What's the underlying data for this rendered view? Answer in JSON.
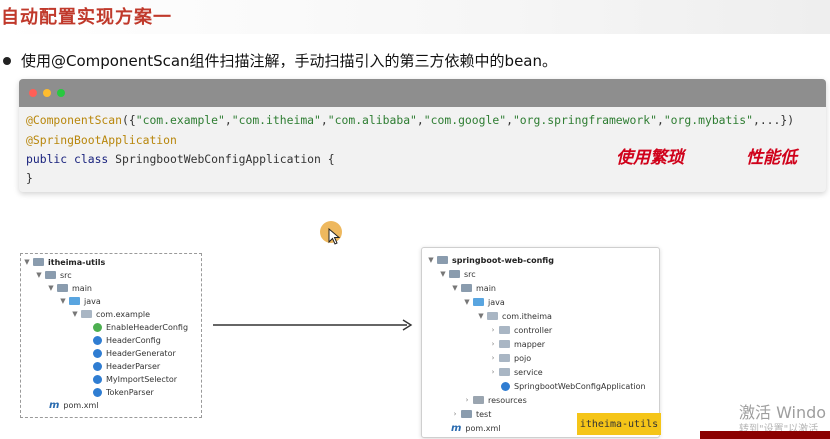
{
  "slide": {
    "title": "自动配置实现方案一",
    "bullet": "使用@ComponentScan组件扫描注解，手动扫描引入的第三方依赖中的bean。"
  },
  "code": {
    "line1": {
      "annotation": "@ComponentScan",
      "open": "({",
      "items": [
        "\"com.example\"",
        "\"com.itheima\"",
        "\"com.alibaba\"",
        "\"com.google\"",
        "\"org.springframework\"",
        "\"org.mybatis\""
      ],
      "tail": ",...})"
    },
    "line2": "@SpringBootApplication",
    "line3": {
      "keyword": "public class",
      "rest": " SpringbootWebConfigApplication {"
    },
    "line4": "}",
    "note_left": "使用繁琐",
    "note_right": "性能低"
  },
  "left_tree": {
    "root": "itheima-utils",
    "src": "src",
    "main": "main",
    "java": "java",
    "package": "com.example",
    "classes": [
      "EnableHeaderConfig",
      "HeaderConfig",
      "HeaderGenerator",
      "HeaderParser",
      "MyImportSelector",
      "TokenParser"
    ],
    "pom": "pom.xml"
  },
  "right_tree": {
    "root": "springboot-web-config",
    "src": "src",
    "main": "main",
    "java": "java",
    "package": "com.itheima",
    "subpackages": [
      "controller",
      "mapper",
      "pojo",
      "service"
    ],
    "app_class": "SpringbootWebConfigApplication",
    "resources": "resources",
    "test": "test",
    "pom": "pom.xml"
  },
  "tooltip_label": "itheima-utils",
  "watermark": {
    "line1": "激活 Windo",
    "line2": "转到\"设置\"以激活"
  },
  "colors": {
    "title": "#c0392b",
    "handwriting": "#d0021b",
    "annotation": "#b8860b",
    "string": "#2e7d32",
    "keyword": "#1a237e",
    "tooltip": "#f5c518"
  }
}
